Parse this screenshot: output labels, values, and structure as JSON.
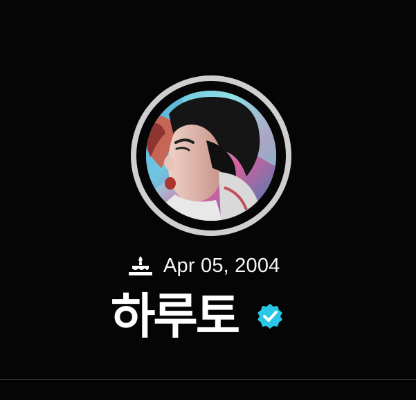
{
  "profile": {
    "birthday": "Apr 05, 2004",
    "name": "하루토",
    "verified": true,
    "avatar": {
      "description": "profile photo"
    }
  },
  "icons": {
    "birthday": "cake-icon",
    "verified": "verified-badge-icon"
  },
  "colors": {
    "background": "#050505",
    "ring": "#cfcfcf",
    "text": "#ffffff",
    "verified": "#2ac7e8"
  }
}
